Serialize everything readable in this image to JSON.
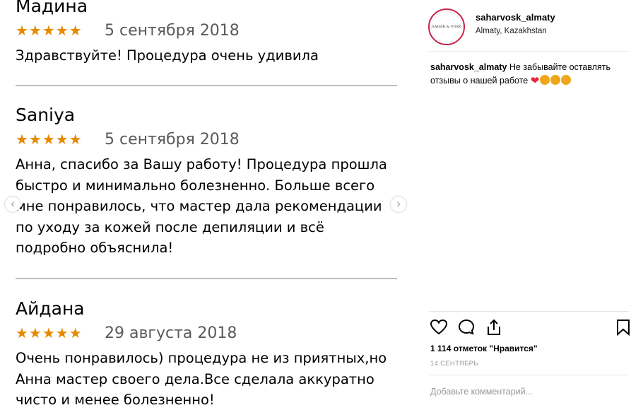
{
  "reviews": [
    {
      "name": "Мадина",
      "stars": "★★★★★",
      "date": "5 сентября 2018",
      "text": "Здравствуйте! Процедура очень удивила"
    },
    {
      "name": "Saniya",
      "stars": "★★★★★",
      "date": "5 сентября 2018",
      "text_lines": [
        "Анна, спасибо за Вашу работу! Процедура прошла",
        "быстро и минимально болезненно. Больше всего",
        "мне понравилось, что мастер дала рекомендации",
        "по уходу за кожей после депиляции и всё",
        "подробно объяснила!"
      ]
    },
    {
      "name": "Айдана",
      "stars": "★★★★★",
      "date": "29 августа 2018",
      "text_lines": [
        "Очень понравилось) процедура не из приятных,но",
        "Анна мастер своего дела.Все сделала аккуратно",
        "чисто и менее болезненно!"
      ]
    }
  ],
  "nav": {
    "prev": "‹",
    "next": "›"
  },
  "post": {
    "avatar_text": "SAHAR & VOSK",
    "username": "saharvosk_almaty",
    "location": "Almaty, Kazakhstan",
    "caption_user": "saharvosk_almaty",
    "caption_text": "Не забывайте оставлять отзывы о нашей работе",
    "likes": "1 114 отметок \"Нравится\"",
    "date": "14 СЕНТЯБРЬ",
    "comment_placeholder": "Добавьте комментарий..."
  },
  "colors": {
    "star": "#e58a00",
    "accent": "#c8224a",
    "heart": "#e8233a"
  },
  "icons": [
    "heart-icon",
    "comment-icon",
    "share-icon",
    "bookmark-icon",
    "chevron-left-icon",
    "chevron-right-icon"
  ]
}
